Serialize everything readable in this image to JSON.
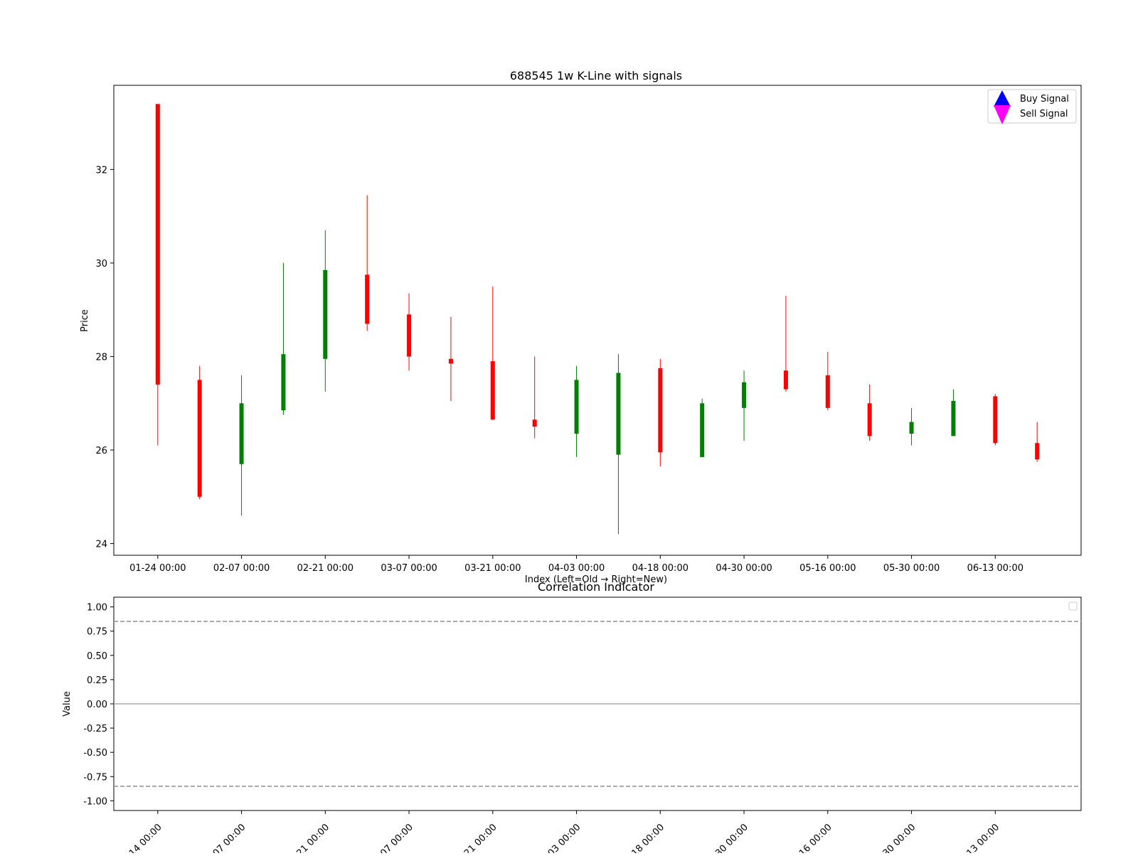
{
  "chart_data": [
    {
      "type": "candlestick",
      "title": "688545 1w K-Line with signals",
      "xlabel": "Index (Left=Old → Right=New)",
      "ylabel": "Price",
      "ylim": [
        23.75,
        33.8
      ],
      "yticks": [
        24,
        26,
        28,
        30,
        32
      ],
      "xticks": [
        {
          "index": 0,
          "label": "01-24 00:00"
        },
        {
          "index": 2,
          "label": "02-07 00:00"
        },
        {
          "index": 4,
          "label": "02-21 00:00"
        },
        {
          "index": 6,
          "label": "03-07 00:00"
        },
        {
          "index": 8,
          "label": "03-21 00:00"
        },
        {
          "index": 10,
          "label": "04-03 00:00"
        },
        {
          "index": 12,
          "label": "04-18 00:00"
        },
        {
          "index": 14,
          "label": "04-30 00:00"
        },
        {
          "index": 16,
          "label": "05-16 00:00"
        },
        {
          "index": 18,
          "label": "05-30 00:00"
        },
        {
          "index": 20,
          "label": "06-13 00:00"
        }
      ],
      "xlim": [
        -1.05,
        22.05
      ],
      "candles": [
        {
          "open": 33.4,
          "close": 27.4,
          "high": 33.4,
          "low": 26.1
        },
        {
          "open": 27.5,
          "close": 25.0,
          "high": 27.8,
          "low": 24.95
        },
        {
          "open": 25.7,
          "close": 27.0,
          "high": 27.6,
          "low": 24.6
        },
        {
          "open": 26.85,
          "close": 28.05,
          "high": 30.0,
          "low": 26.75
        },
        {
          "open": 27.95,
          "close": 29.85,
          "high": 30.7,
          "low": 27.25
        },
        {
          "open": 29.75,
          "close": 28.7,
          "high": 31.45,
          "low": 28.55
        },
        {
          "open": 28.9,
          "close": 28.0,
          "high": 29.35,
          "low": 27.7
        },
        {
          "open": 27.95,
          "close": 27.85,
          "high": 28.85,
          "low": 27.05
        },
        {
          "open": 27.9,
          "close": 26.65,
          "high": 29.5,
          "low": 26.65
        },
        {
          "open": 26.65,
          "close": 26.5,
          "high": 28.0,
          "low": 26.25
        },
        {
          "open": 26.35,
          "close": 27.5,
          "high": 27.8,
          "low": 25.85
        },
        {
          "open": 25.9,
          "close": 27.65,
          "high": 28.05,
          "low": 24.2
        },
        {
          "open": 27.75,
          "close": 25.95,
          "high": 27.95,
          "low": 25.65
        },
        {
          "open": 25.85,
          "close": 27.0,
          "high": 27.1,
          "low": 25.85
        },
        {
          "open": 26.9,
          "close": 27.45,
          "high": 27.7,
          "low": 26.2
        },
        {
          "open": 27.7,
          "close": 27.3,
          "high": 29.3,
          "low": 27.25
        },
        {
          "open": 27.6,
          "close": 26.9,
          "high": 28.1,
          "low": 26.85
        },
        {
          "open": 27.0,
          "close": 26.3,
          "high": 27.4,
          "low": 26.2
        },
        {
          "open": 26.35,
          "close": 26.6,
          "high": 26.9,
          "low": 26.1
        },
        {
          "open": 26.3,
          "close": 27.05,
          "high": 27.3,
          "low": 26.3
        },
        {
          "open": 27.15,
          "close": 26.15,
          "high": 27.2,
          "low": 26.1
        },
        {
          "open": 26.15,
          "close": 25.8,
          "high": 26.6,
          "low": 25.75
        }
      ],
      "up_color": "#008000",
      "down_color": "#ff0000",
      "legend": {
        "placement": "top-right",
        "entries": [
          {
            "label": "Buy Signal",
            "marker": "triangle-up",
            "color": "#0000ff"
          },
          {
            "label": "Sell Signal",
            "marker": "triangle-down",
            "color": "#ff00ff"
          }
        ]
      },
      "grid": false
    },
    {
      "type": "line",
      "title": "Correlation Indicator",
      "ylabel": "Value",
      "ylim": [
        -1.1,
        1.1
      ],
      "yticks": [
        "1.00",
        "0.75",
        "0.50",
        "0.25",
        "0.00",
        "-0.25",
        "-0.50",
        "-0.75",
        "-1.00"
      ],
      "reference_lines": [
        {
          "y": 0.85,
          "style": "dashed",
          "color": "#999999"
        },
        {
          "y": 0.0,
          "style": "solid",
          "color": "#aaaaaa"
        },
        {
          "y": -0.85,
          "style": "dashed",
          "color": "#999999"
        }
      ],
      "xticks_rotated": [
        "14 00:00",
        "07 00:00",
        "21 00:00",
        "07 00:00",
        "21 00:00",
        "03 00:00",
        "18 00:00",
        "30 00:00",
        "16 00:00",
        "30 00:00",
        "13 00:00"
      ],
      "legend": {
        "placement": "top-right",
        "entries": []
      },
      "series": []
    }
  ]
}
